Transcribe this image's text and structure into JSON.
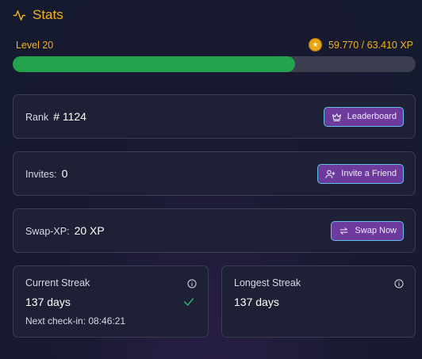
{
  "header": {
    "title": "Stats",
    "icon": "activity-icon"
  },
  "level": {
    "label": "Level 20",
    "xp_text": "59.770 / 63.410 XP",
    "progress_fraction": 0.7
  },
  "rank": {
    "label": "Rank",
    "value": "# 1124",
    "button_label": "Leaderboard"
  },
  "invites": {
    "label": "Invites:",
    "value": "0",
    "button_label": "Invite a Friend"
  },
  "swap": {
    "label": "Swap-XP:",
    "value": "20 XP",
    "button_label": "Swap Now"
  },
  "current_streak": {
    "title": "Current Streak",
    "value": "137 days",
    "next_checkin": "Next check-in: 08:46:21"
  },
  "longest_streak": {
    "title": "Longest Streak",
    "value": "137 days"
  },
  "colors": {
    "accent": "#f3b21b",
    "progress": "#22a24c",
    "button_bg": "#6d3a9e",
    "button_border": "#5fc0e8",
    "check": "#2bb673"
  }
}
